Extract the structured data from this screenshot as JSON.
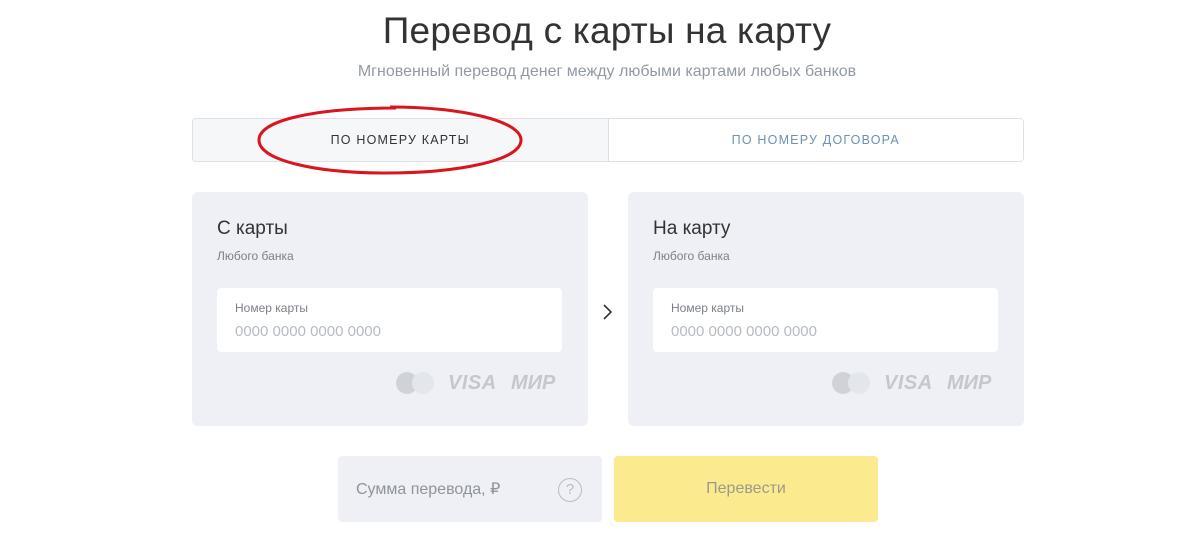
{
  "header": {
    "title": "Перевод с карты на карту",
    "subtitle": "Мгновенный перевод денег между любыми картами любых банков"
  },
  "tabs": [
    {
      "label": "По номеру карты",
      "active": true
    },
    {
      "label": "По номеру договора",
      "active": false
    }
  ],
  "cards": {
    "from": {
      "title": "С карты",
      "subtitle": "Любого банка",
      "field_label": "Номер карты",
      "placeholder": "0000 0000 0000 0000"
    },
    "to": {
      "title": "На карту",
      "subtitle": "Любого банка",
      "field_label": "Номер карты",
      "placeholder": "0000 0000 0000 0000"
    }
  },
  "logos": {
    "visa": "VISA",
    "mir": "МИР",
    "mastercard_icon": "mastercard-icon"
  },
  "amount": {
    "placeholder": "Сумма перевода, ₽",
    "help_icon": "?"
  },
  "submit": {
    "label": "Перевести"
  },
  "colors": {
    "highlight": "#d9151f",
    "submit_bg": "#fbea8e",
    "card_bg": "#eef0f5",
    "tab_inactive_text": "#6e90b2"
  }
}
